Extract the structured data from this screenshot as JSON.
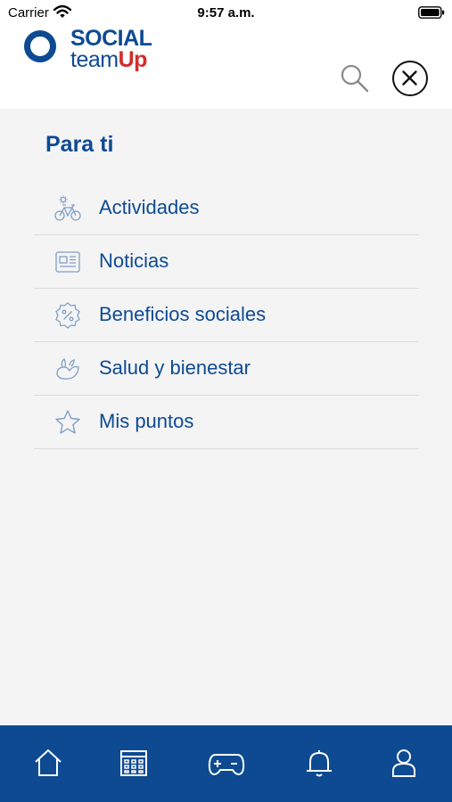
{
  "status_bar": {
    "carrier": "Carrier",
    "time": "9:57 a.m."
  },
  "brand": {
    "line1": "SOCIAL",
    "team": "team",
    "up": "Up",
    "primary_color": "#0d4a92",
    "accent_color": "#d32c2b"
  },
  "header": {
    "search_icon": "search-icon",
    "close_icon": "close-icon"
  },
  "section": {
    "title": "Para ti"
  },
  "menu": {
    "items": [
      {
        "label": "Actividades",
        "icon": "bicycle-icon"
      },
      {
        "label": "Noticias",
        "icon": "newspaper-icon"
      },
      {
        "label": "Beneficios sociales",
        "icon": "discount-badge-icon"
      },
      {
        "label": "Salud y bienestar",
        "icon": "wellness-icon"
      },
      {
        "label": "Mis puntos",
        "icon": "star-icon"
      }
    ]
  },
  "tab_bar": {
    "tabs": [
      {
        "icon": "home-icon"
      },
      {
        "icon": "calendar-icon"
      },
      {
        "icon": "gamepad-icon"
      },
      {
        "icon": "bell-icon"
      },
      {
        "icon": "profile-icon"
      }
    ]
  }
}
